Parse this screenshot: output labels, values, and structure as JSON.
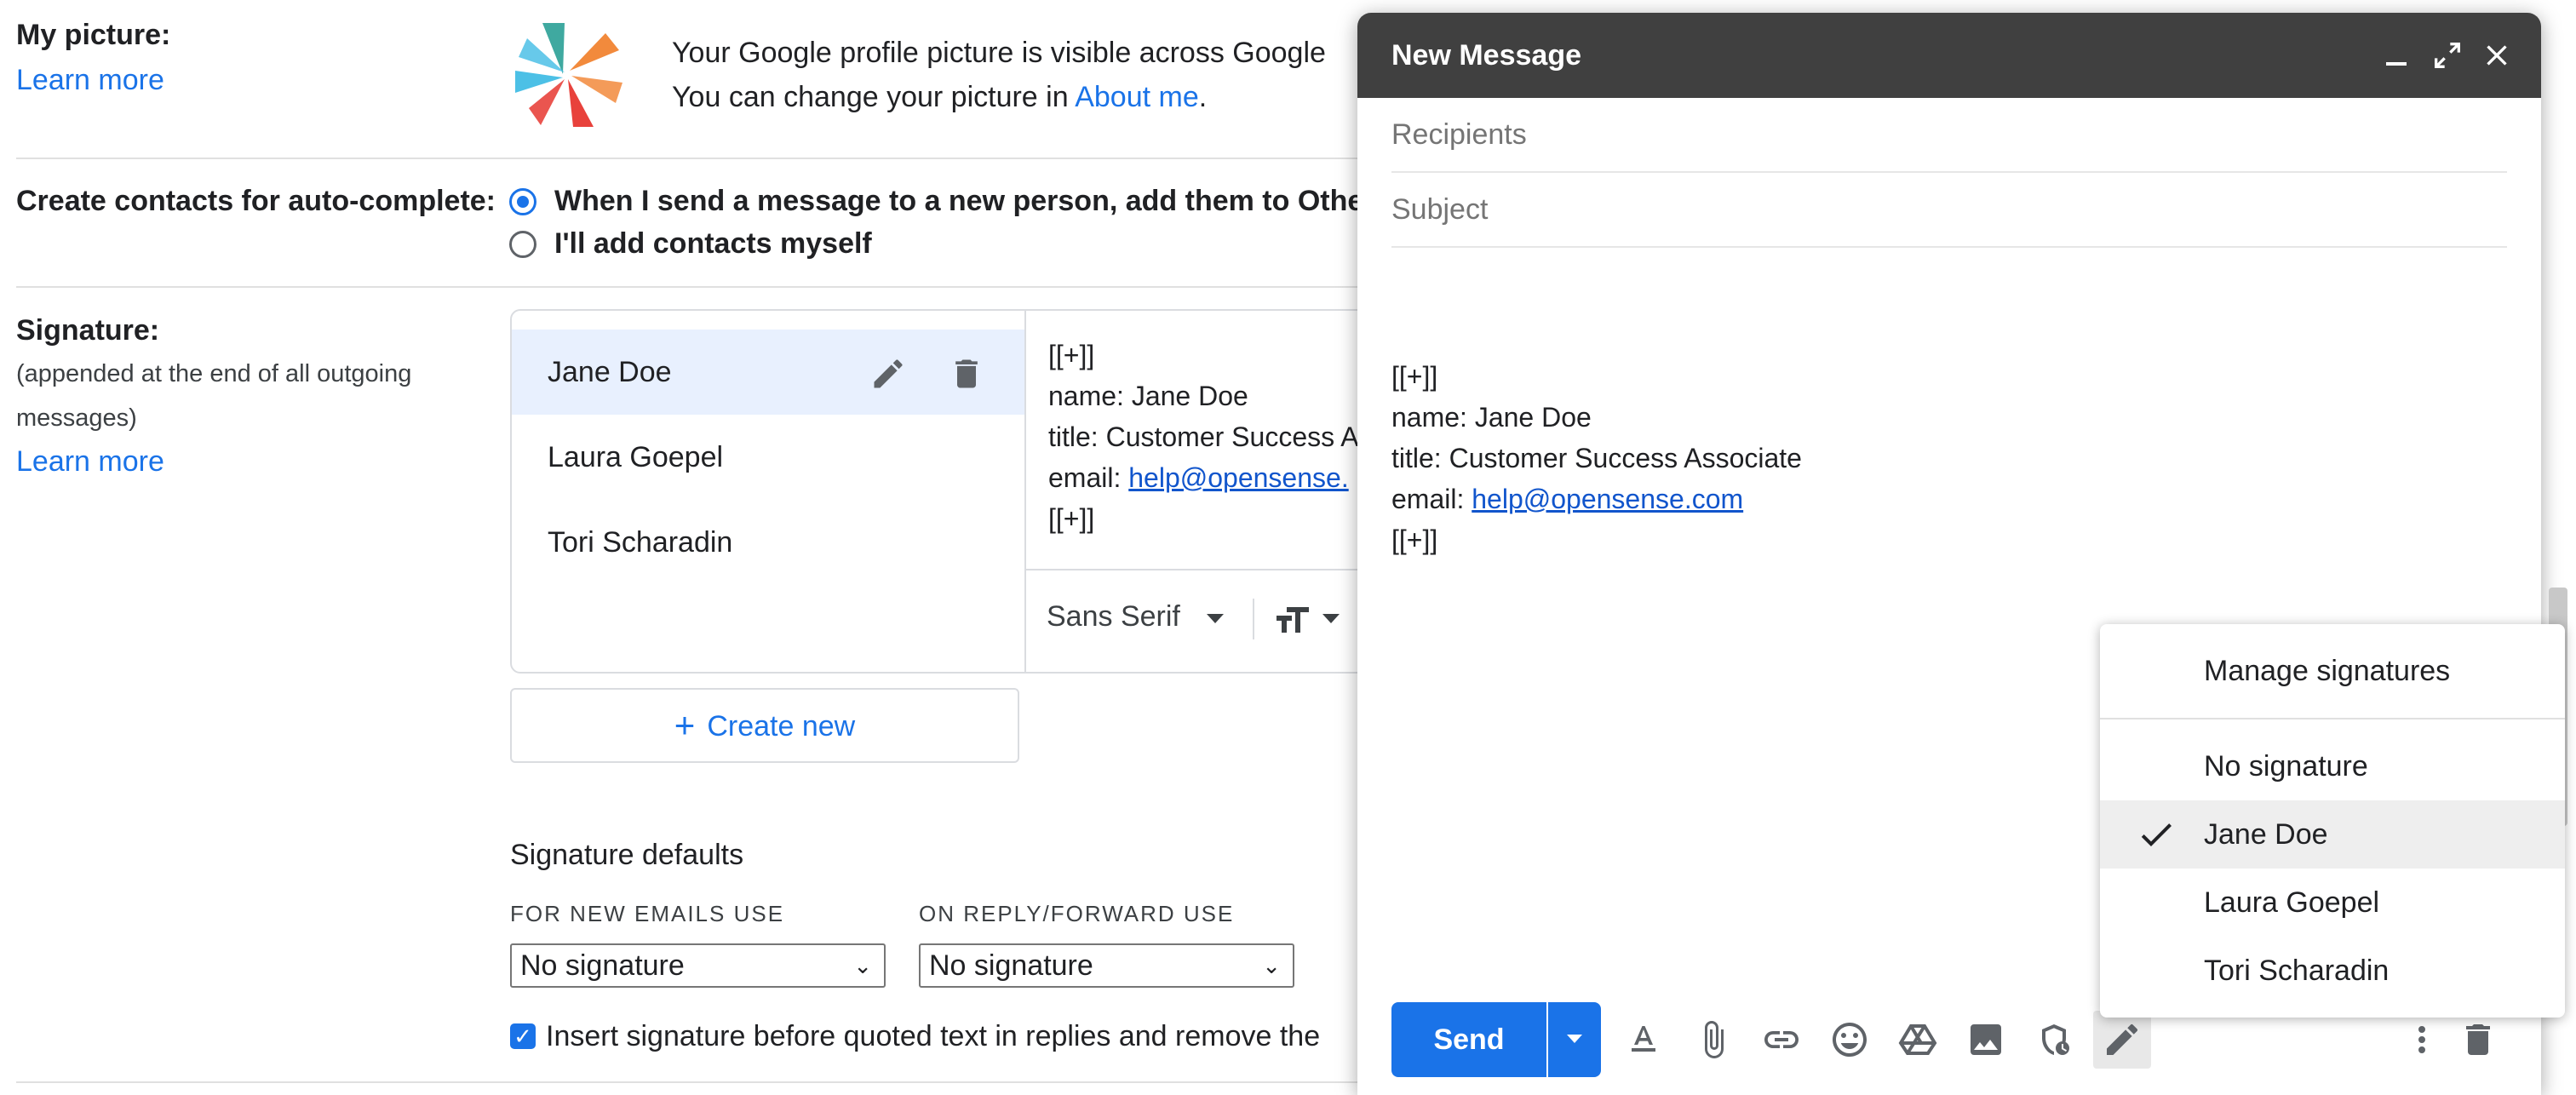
{
  "settings": {
    "my_picture": {
      "label": "My picture:",
      "learn_more": "Learn more",
      "desc_line1": "Your Google profile picture is visible across Google",
      "desc_line2_prefix": "You can change your picture in ",
      "about_me": "About me",
      "desc_line2_suffix": "."
    },
    "contacts": {
      "label": "Create contacts for auto-complete:",
      "option1": "When I send a message to a new person, add them to Othe",
      "option2": "I'll add contacts myself"
    },
    "signature": {
      "label": "Signature:",
      "sub1": "(appended at the end of all outgoing",
      "sub2": "messages)",
      "learn_more": "Learn more",
      "items": [
        "Jane Doe",
        "Laura Goepel",
        "Tori Scharadin"
      ],
      "preview": {
        "line1": "[[+]]",
        "line2": "name: Jane Doe",
        "line3": "title: Customer Success A",
        "line4_prefix": "email: ",
        "line4_link": "help@opensense.",
        "line5": "[[+]]"
      },
      "font_select": "Sans Serif",
      "create_new": "Create new"
    },
    "defaults": {
      "title": "Signature defaults",
      "new_label": "FOR NEW EMAILS USE",
      "reply_label": "ON REPLY/FORWARD USE",
      "new_value": "No signature",
      "reply_value": "No signature",
      "insert_text": "Insert signature before quoted text in replies and remove the"
    }
  },
  "compose": {
    "title": "New Message",
    "recipients_placeholder": "Recipients",
    "subject_placeholder": "Subject",
    "body": {
      "line1": "[[+]]",
      "line2": "name: Jane Doe",
      "line3": "title: Customer Success Associate",
      "line4_prefix": "email: ",
      "line4_link": "help@opensense.com",
      "line5": "[[+]]"
    },
    "send_label": "Send"
  },
  "signature_menu": {
    "manage": "Manage signatures",
    "items": [
      "No signature",
      "Jane Doe",
      "Laura Goepel",
      "Tori Scharadin"
    ],
    "selected": "Jane Doe"
  },
  "colors": {
    "accent": "#1a73e8",
    "header": "#404040"
  }
}
